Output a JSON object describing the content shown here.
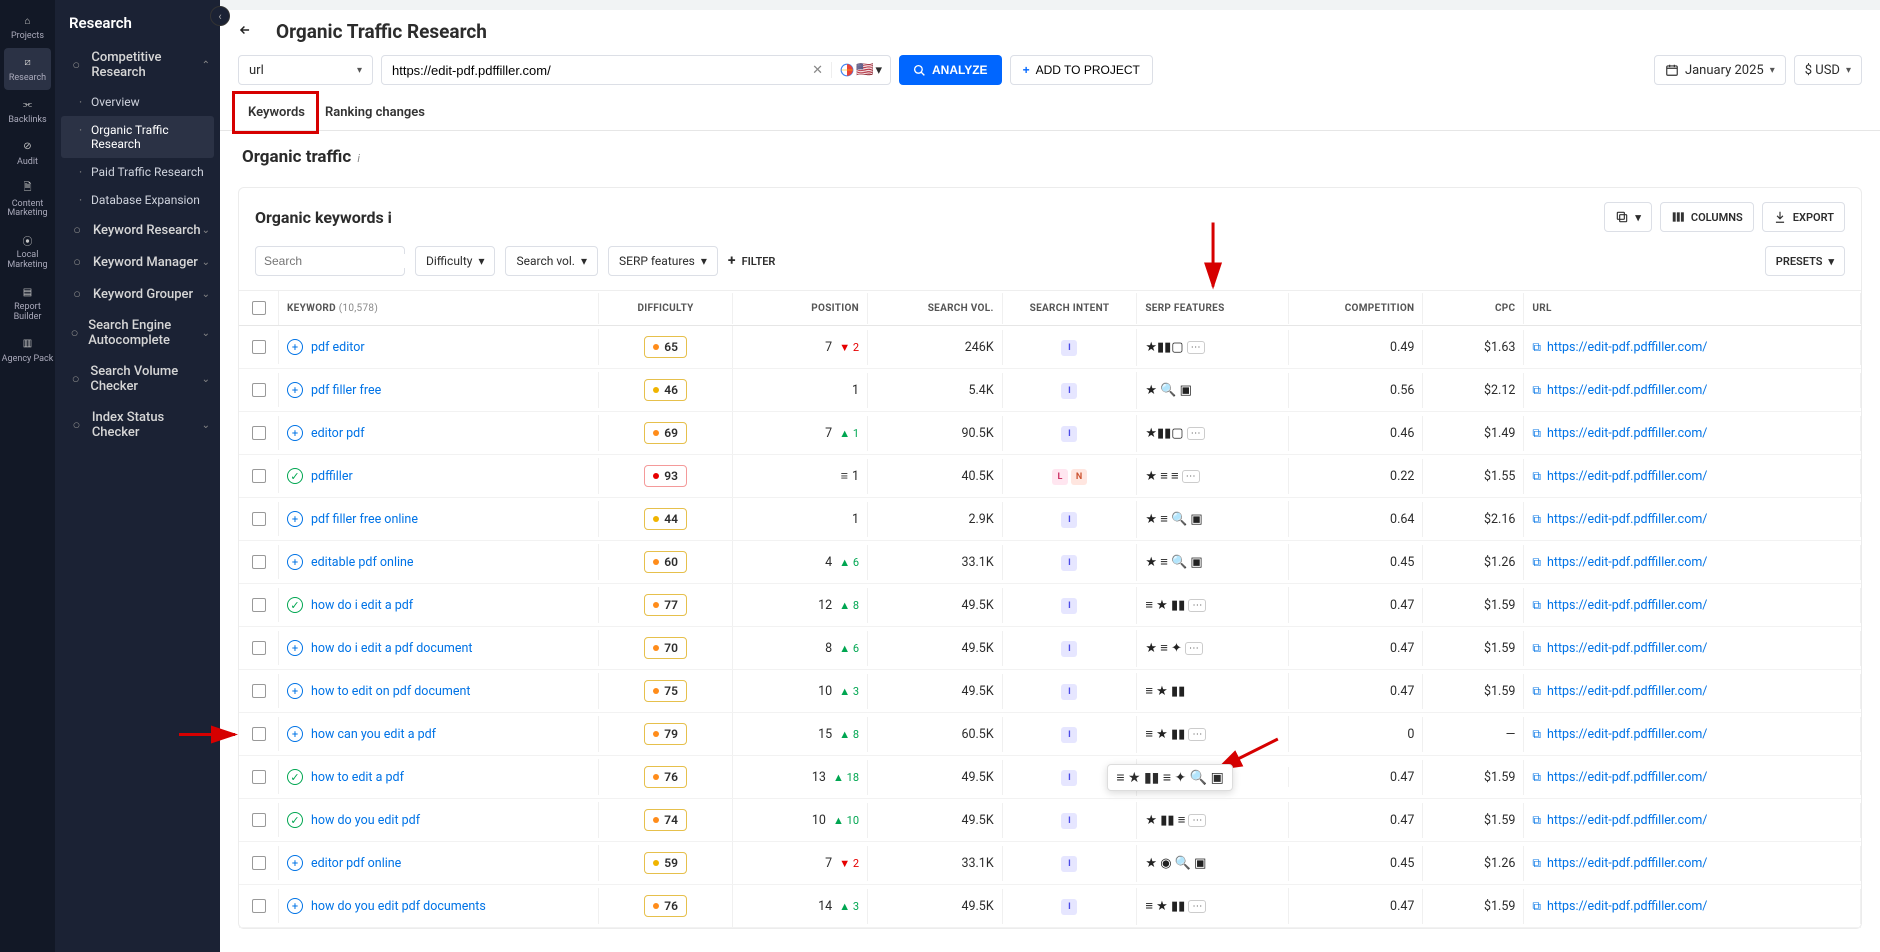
{
  "rail": [
    {
      "label": "Projects",
      "icon": "home"
    },
    {
      "label": "Research",
      "icon": "search",
      "active": true
    },
    {
      "label": "Backlinks",
      "icon": "link"
    },
    {
      "label": "Audit",
      "icon": "check"
    },
    {
      "label": "Content Marketing",
      "icon": "doc"
    },
    {
      "label": "Local Marketing",
      "icon": "pin"
    },
    {
      "label": "Report Builder",
      "icon": "report"
    },
    {
      "label": "Agency Pack",
      "icon": "building"
    }
  ],
  "sidebar": {
    "title": "Research",
    "groups": [
      {
        "label": "Competitive Research",
        "expanded": true,
        "items": [
          {
            "label": "Overview"
          },
          {
            "label": "Organic Traffic Research",
            "active": true
          },
          {
            "label": "Paid Traffic Research"
          },
          {
            "label": "Database Expansion"
          }
        ]
      },
      {
        "label": "Keyword Research"
      },
      {
        "label": "Keyword Manager"
      },
      {
        "label": "Keyword Grouper"
      },
      {
        "label": "Search Engine Autocomplete"
      },
      {
        "label": "Search Volume Checker"
      },
      {
        "label": "Index Status Checker"
      }
    ]
  },
  "page": {
    "title": "Organic Traffic Research",
    "mode": "url",
    "url_value": "https://edit-pdf.pdffiller.com/",
    "analyze": "ANALYZE",
    "add_project": "ADD TO PROJECT",
    "date": "January 2025",
    "currency": "$ USD"
  },
  "tabs": [
    {
      "label": "Keywords",
      "active": true
    },
    {
      "label": "Ranking changes"
    }
  ],
  "section": {
    "title": "Organic traffic"
  },
  "card": {
    "title": "Organic keywords",
    "search_placeholder": "Search",
    "dd_difficulty": "Difficulty",
    "dd_volume": "Search vol.",
    "dd_serp": "SERP features",
    "filter": "FILTER",
    "columns": "COLUMNS",
    "export": "EXPORT",
    "presets": "PRESETS"
  },
  "table": {
    "count": "10,578",
    "headers": {
      "kw": "KEYWORD",
      "diff": "DIFFICULTY",
      "pos": "POSITION",
      "vol": "SEARCH VOL.",
      "intent": "SEARCH INTENT",
      "serp": "SERP FEATURES",
      "comp": "COMPETITION",
      "cpc": "CPC",
      "url": "URL"
    },
    "rows": [
      {
        "kw": "pdf editor",
        "add": "plus",
        "diff": 65,
        "diffc": "o",
        "pos": "7",
        "pchg": "▼ 2",
        "pdir": "down",
        "vol": "246K",
        "intent": [
          "I"
        ],
        "serp": "★▮▮▢",
        "serpMore": true,
        "comp": "0.49",
        "cpc": "$1.63",
        "url": "https://edit-pdf.pdffiller.com/"
      },
      {
        "kw": "pdf filler free",
        "add": "plus",
        "diff": 46,
        "diffc": "y",
        "pos": "1",
        "pchg": "",
        "pdir": "",
        "vol": "5.4K",
        "intent": [
          "I"
        ],
        "serp": "★ 🔍 ▣",
        "comp": "0.56",
        "cpc": "$2.12",
        "url": "https://edit-pdf.pdffiller.com/"
      },
      {
        "kw": "editor pdf",
        "add": "plus",
        "diff": 69,
        "diffc": "o",
        "pos": "7",
        "pchg": "▲ 1",
        "pdir": "up",
        "vol": "90.5K",
        "intent": [
          "I"
        ],
        "serp": "★▮▮▢",
        "serpMore": true,
        "comp": "0.46",
        "cpc": "$1.49",
        "url": "https://edit-pdf.pdffiller.com/"
      },
      {
        "kw": "pdffiller",
        "add": "check",
        "diff": 93,
        "diffc": "r",
        "pos": "1",
        "pchg": "",
        "pdir": "",
        "posicon": "list",
        "vol": "40.5K",
        "intent": [
          "L",
          "N"
        ],
        "serp": "★ ≡ ≡",
        "serpMore": true,
        "comp": "0.22",
        "cpc": "$1.55",
        "url": "https://edit-pdf.pdffiller.com/"
      },
      {
        "kw": "pdf filler free online",
        "add": "plus",
        "diff": 44,
        "diffc": "y",
        "pos": "1",
        "pchg": "",
        "pdir": "",
        "vol": "2.9K",
        "intent": [
          "I"
        ],
        "serp": "★ ≡ 🔍 ▣",
        "comp": "0.64",
        "cpc": "$2.16",
        "url": "https://edit-pdf.pdffiller.com/"
      },
      {
        "kw": "editable pdf online",
        "add": "plus",
        "diff": 60,
        "diffc": "o",
        "pos": "4",
        "pchg": "▲ 6",
        "pdir": "up",
        "vol": "33.1K",
        "intent": [
          "I"
        ],
        "serp": "★ ≡ 🔍 ▣",
        "comp": "0.45",
        "cpc": "$1.26",
        "url": "https://edit-pdf.pdffiller.com/"
      },
      {
        "kw": "how do i edit a pdf",
        "add": "check",
        "diff": 77,
        "diffc": "o",
        "pos": "12",
        "pchg": "▲ 8",
        "pdir": "up",
        "vol": "49.5K",
        "intent": [
          "I"
        ],
        "serp": "≡ ★ ▮▮",
        "serpMore": true,
        "comp": "0.47",
        "cpc": "$1.59",
        "url": "https://edit-pdf.pdffiller.com/"
      },
      {
        "kw": "how do i edit a pdf document",
        "add": "plus",
        "diff": 70,
        "diffc": "o",
        "pos": "8",
        "pchg": "▲ 6",
        "pdir": "up",
        "vol": "49.5K",
        "intent": [
          "I"
        ],
        "serp": "★ ≡ ✦",
        "serpMore": true,
        "comp": "0.47",
        "cpc": "$1.59",
        "url": "https://edit-pdf.pdffiller.com/"
      },
      {
        "kw": "how to edit on pdf document",
        "add": "plus",
        "diff": 75,
        "diffc": "o",
        "pos": "10",
        "pchg": "▲ 3",
        "pdir": "up",
        "vol": "49.5K",
        "intent": [
          "I"
        ],
        "serp": "≡ ★ ▮▮",
        "comp": "0.47",
        "cpc": "$1.59",
        "url": "https://edit-pdf.pdffiller.com/"
      },
      {
        "kw": "how can you edit a pdf",
        "add": "plus",
        "diff": 79,
        "diffc": "o",
        "pos": "15",
        "pchg": "▲ 8",
        "pdir": "up",
        "vol": "60.5K",
        "intent": [
          "I"
        ],
        "serp": "≡ ★ ▮▮",
        "serpMore": true,
        "comp": "0",
        "cpc": "—",
        "url": "https://edit-pdf.pdffiller.com/"
      },
      {
        "kw": "how to edit a pdf",
        "add": "check",
        "diff": 76,
        "diffc": "o",
        "pos": "13",
        "pchg": "▲ 18",
        "pdir": "up",
        "vol": "49.5K",
        "intent": [
          "I"
        ],
        "serp": "",
        "tooltip": true,
        "comp": "0.47",
        "cpc": "$1.59",
        "url": "https://edit-pdf.pdffiller.com/"
      },
      {
        "kw": "how do you edit pdf",
        "add": "check",
        "diff": 74,
        "diffc": "o",
        "pos": "10",
        "pchg": "▲ 10",
        "pdir": "up",
        "vol": "49.5K",
        "intent": [
          "I"
        ],
        "serp": "★ ▮▮ ≡",
        "serpMore": true,
        "comp": "0.47",
        "cpc": "$1.59",
        "url": "https://edit-pdf.pdffiller.com/"
      },
      {
        "kw": "editor pdf online",
        "add": "plus",
        "diff": 59,
        "diffc": "y",
        "pos": "7",
        "pchg": "▼ 2",
        "pdir": "down",
        "vol": "33.1K",
        "intent": [
          "I"
        ],
        "serp": "★ ◉ 🔍 ▣",
        "comp": "0.45",
        "cpc": "$1.26",
        "url": "https://edit-pdf.pdffiller.com/"
      },
      {
        "kw": "how do you edit pdf documents",
        "add": "plus",
        "diff": 76,
        "diffc": "o",
        "pos": "14",
        "pchg": "▲ 3",
        "pdir": "up",
        "vol": "49.5K",
        "intent": [
          "I"
        ],
        "serp": "≡ ★ ▮▮",
        "serpMore": true,
        "comp": "0.47",
        "cpc": "$1.59",
        "url": "https://edit-pdf.pdffiller.com/"
      }
    ]
  },
  "tooltip_serp": "≡ ★ ▮▮ ≡ ✦ 🔍 ▣"
}
